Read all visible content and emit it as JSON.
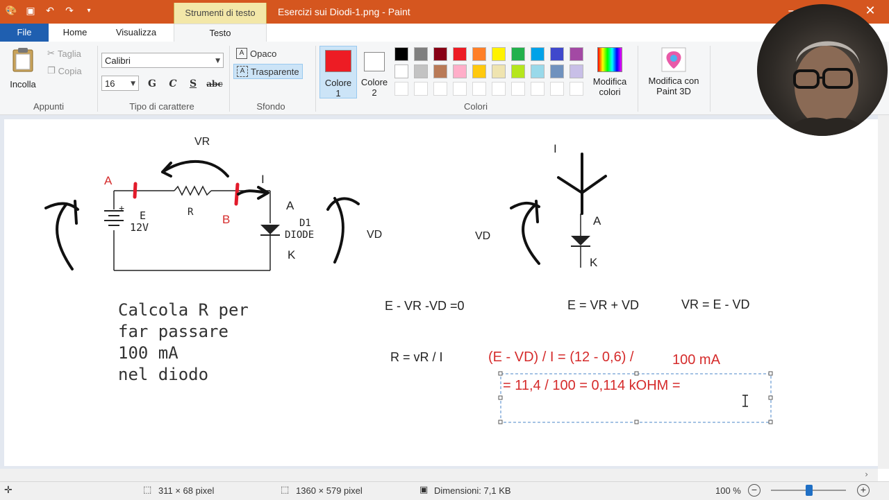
{
  "window": {
    "title": "Esercizi sui Diodi-1.png - Paint",
    "context_tab": "Strumenti di testo"
  },
  "tabs": {
    "file": "File",
    "home": "Home",
    "view": "Visualizza",
    "text": "Testo"
  },
  "clipboard": {
    "paste": "Incolla",
    "cut": "Taglia",
    "copy": "Copia",
    "group": "Appunti"
  },
  "font": {
    "family": "Calibri",
    "size": "16",
    "bold": "G",
    "italic": "C",
    "underline": "S",
    "strike": "abc",
    "group": "Tipo di carattere"
  },
  "background": {
    "opaque": "Opaco",
    "transparent": "Trasparente",
    "group": "Sfondo"
  },
  "colors": {
    "color1_label": "Colore",
    "color1_num": "1",
    "color2_label": "Colore",
    "color2_num": "2",
    "edit": "Modifica",
    "edit2": "colori",
    "group": "Colori",
    "color1": "#ed1c24",
    "color2": "#ffffff",
    "palette_row1": [
      "#000000",
      "#7f7f7f",
      "#880015",
      "#ed1c24",
      "#ff7f27",
      "#fff200",
      "#22b14c",
      "#00a2e8",
      "#3f48cc",
      "#a349a4"
    ],
    "palette_row2": [
      "#ffffff",
      "#c3c3c3",
      "#b97a57",
      "#ffaec9",
      "#ffc90e",
      "#efe4b0",
      "#b5e61d",
      "#99d9ea",
      "#7092be",
      "#c8bfe7"
    ]
  },
  "paint3d": {
    "line1": "Modifica con",
    "line2": "Paint 3D"
  },
  "drawing": {
    "vr_label": "VR",
    "a_label": "A",
    "b_label": "B",
    "i_label": "I",
    "e_label": "E",
    "e_value": "12V",
    "plus": "+",
    "r_label": "R",
    "anode": "A",
    "d1": "D1",
    "diode": "DIODE",
    "cathode": "K",
    "vd_label": "VD",
    "vd_label2": "VD",
    "i2_label": "I",
    "anode2": "A",
    "cathode2": "K",
    "problem": [
      "Calcola R per",
      "far passare",
      "100 mA",
      "nel diodo"
    ],
    "eq1": "E - VR -VD =0",
    "eq2": "E = VR + VD",
    "eq3": "VR = E - VD",
    "eq4": "R = vR / I",
    "eq5": "(E - VD) / I = (12 - 0,6) /",
    "eq5b": "100 mA",
    "eq6": "= 11,4 / 100 = 0,114 kOHM ="
  },
  "status": {
    "selection": "311 × 68 pixel",
    "image_size": "1360 × 579 pixel",
    "file_size": "Dimensioni: 7,1 KB",
    "zoom": "100 %"
  },
  "accent": "#d5561f"
}
